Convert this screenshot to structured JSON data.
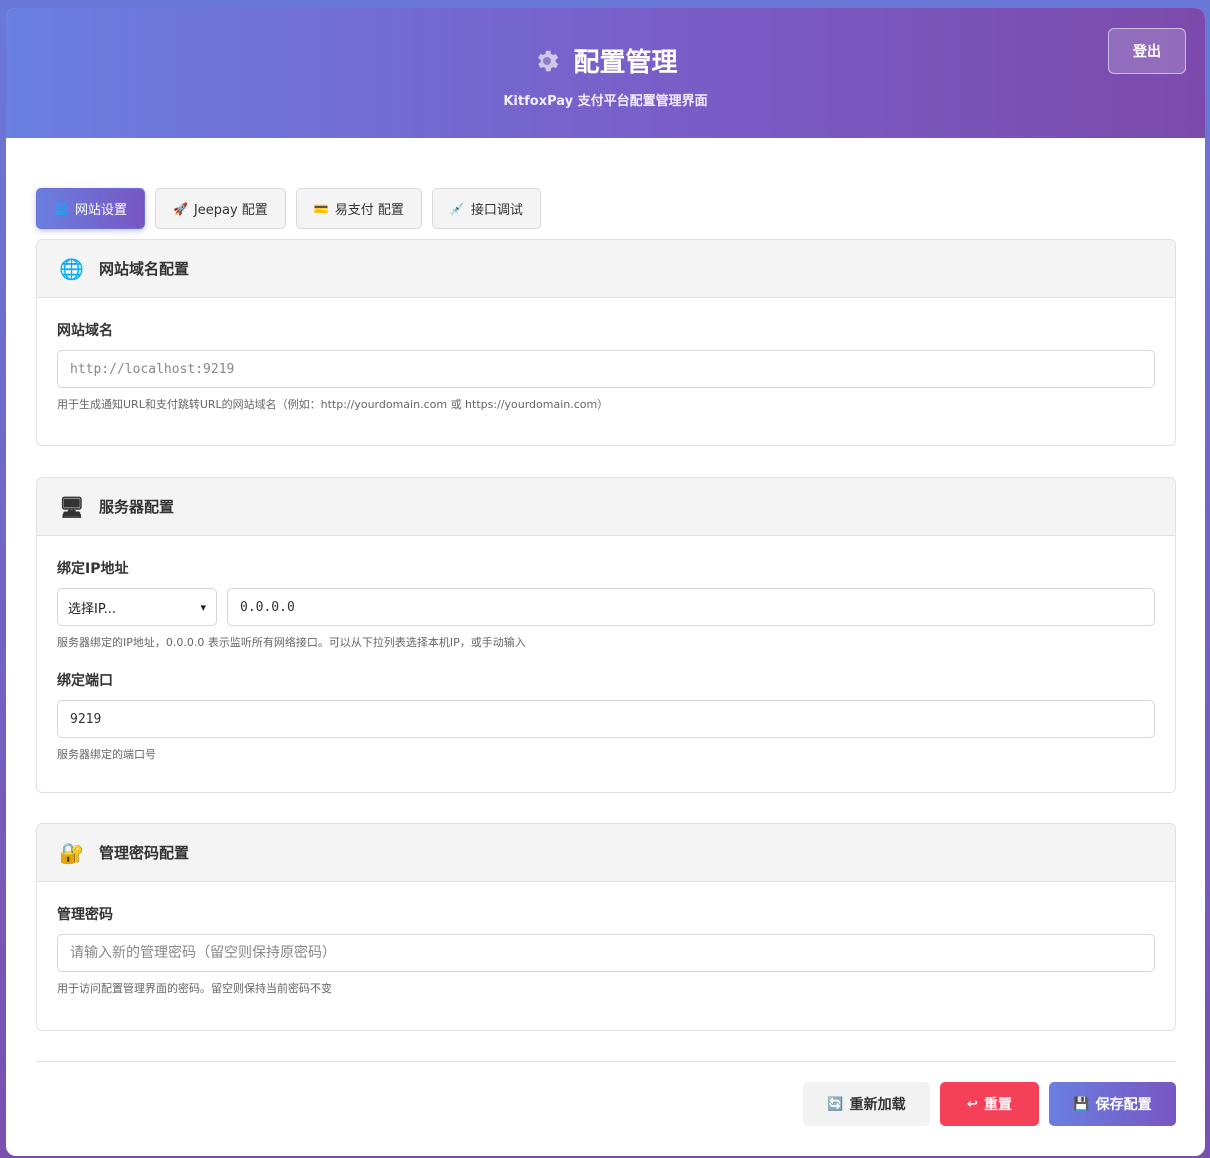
{
  "header": {
    "title": "配置管理",
    "subtitle": "KitfoxPay 支付平台配置管理界面",
    "logout_label": "登出",
    "icon": "gear-icon"
  },
  "tabs": [
    {
      "label": "网站设置",
      "icon": "globe-icon",
      "active": true
    },
    {
      "label": "Jeepay 配置",
      "icon": "rocket-icon",
      "active": false
    },
    {
      "label": "易支付 配置",
      "icon": "card-icon",
      "active": false
    },
    {
      "label": "接口调试",
      "icon": "syringe-icon",
      "active": false
    }
  ],
  "sections": {
    "domain": {
      "title": "网站域名配置",
      "icon": "globe-icon",
      "field_label": "网站域名",
      "placeholder": "http://localhost:9219",
      "hint": "用于生成通知URL和支付跳转URL的网站域名（例如：http://yourdomain.com 或 https://yourdomain.com）"
    },
    "server": {
      "title": "服务器配置",
      "icon": "computer-icon",
      "ip_label": "绑定IP地址",
      "ip_select": "选择IP...",
      "ip_value": "0.0.0.0",
      "ip_hint": "服务器绑定的IP地址，0.0.0.0 表示监听所有网络接口。可以从下拉列表选择本机IP，或手动输入",
      "port_label": "绑定端口",
      "port_value": "9219",
      "port_hint": "服务器绑定的端口号"
    },
    "password": {
      "title": "管理密码配置",
      "icon": "lock-icon",
      "field_label": "管理密码",
      "placeholder": "请输入新的管理密码（留空则保持原密码）",
      "hint": "用于访问配置管理界面的密码。留空则保持当前密码不变"
    }
  },
  "actions": {
    "reload_label": "重新加载",
    "reset_label": "重置",
    "save_label": "保存配置"
  },
  "colors": {
    "accent": "#6a7fe0",
    "accent2": "#7856c2",
    "danger": "#f5405a"
  }
}
